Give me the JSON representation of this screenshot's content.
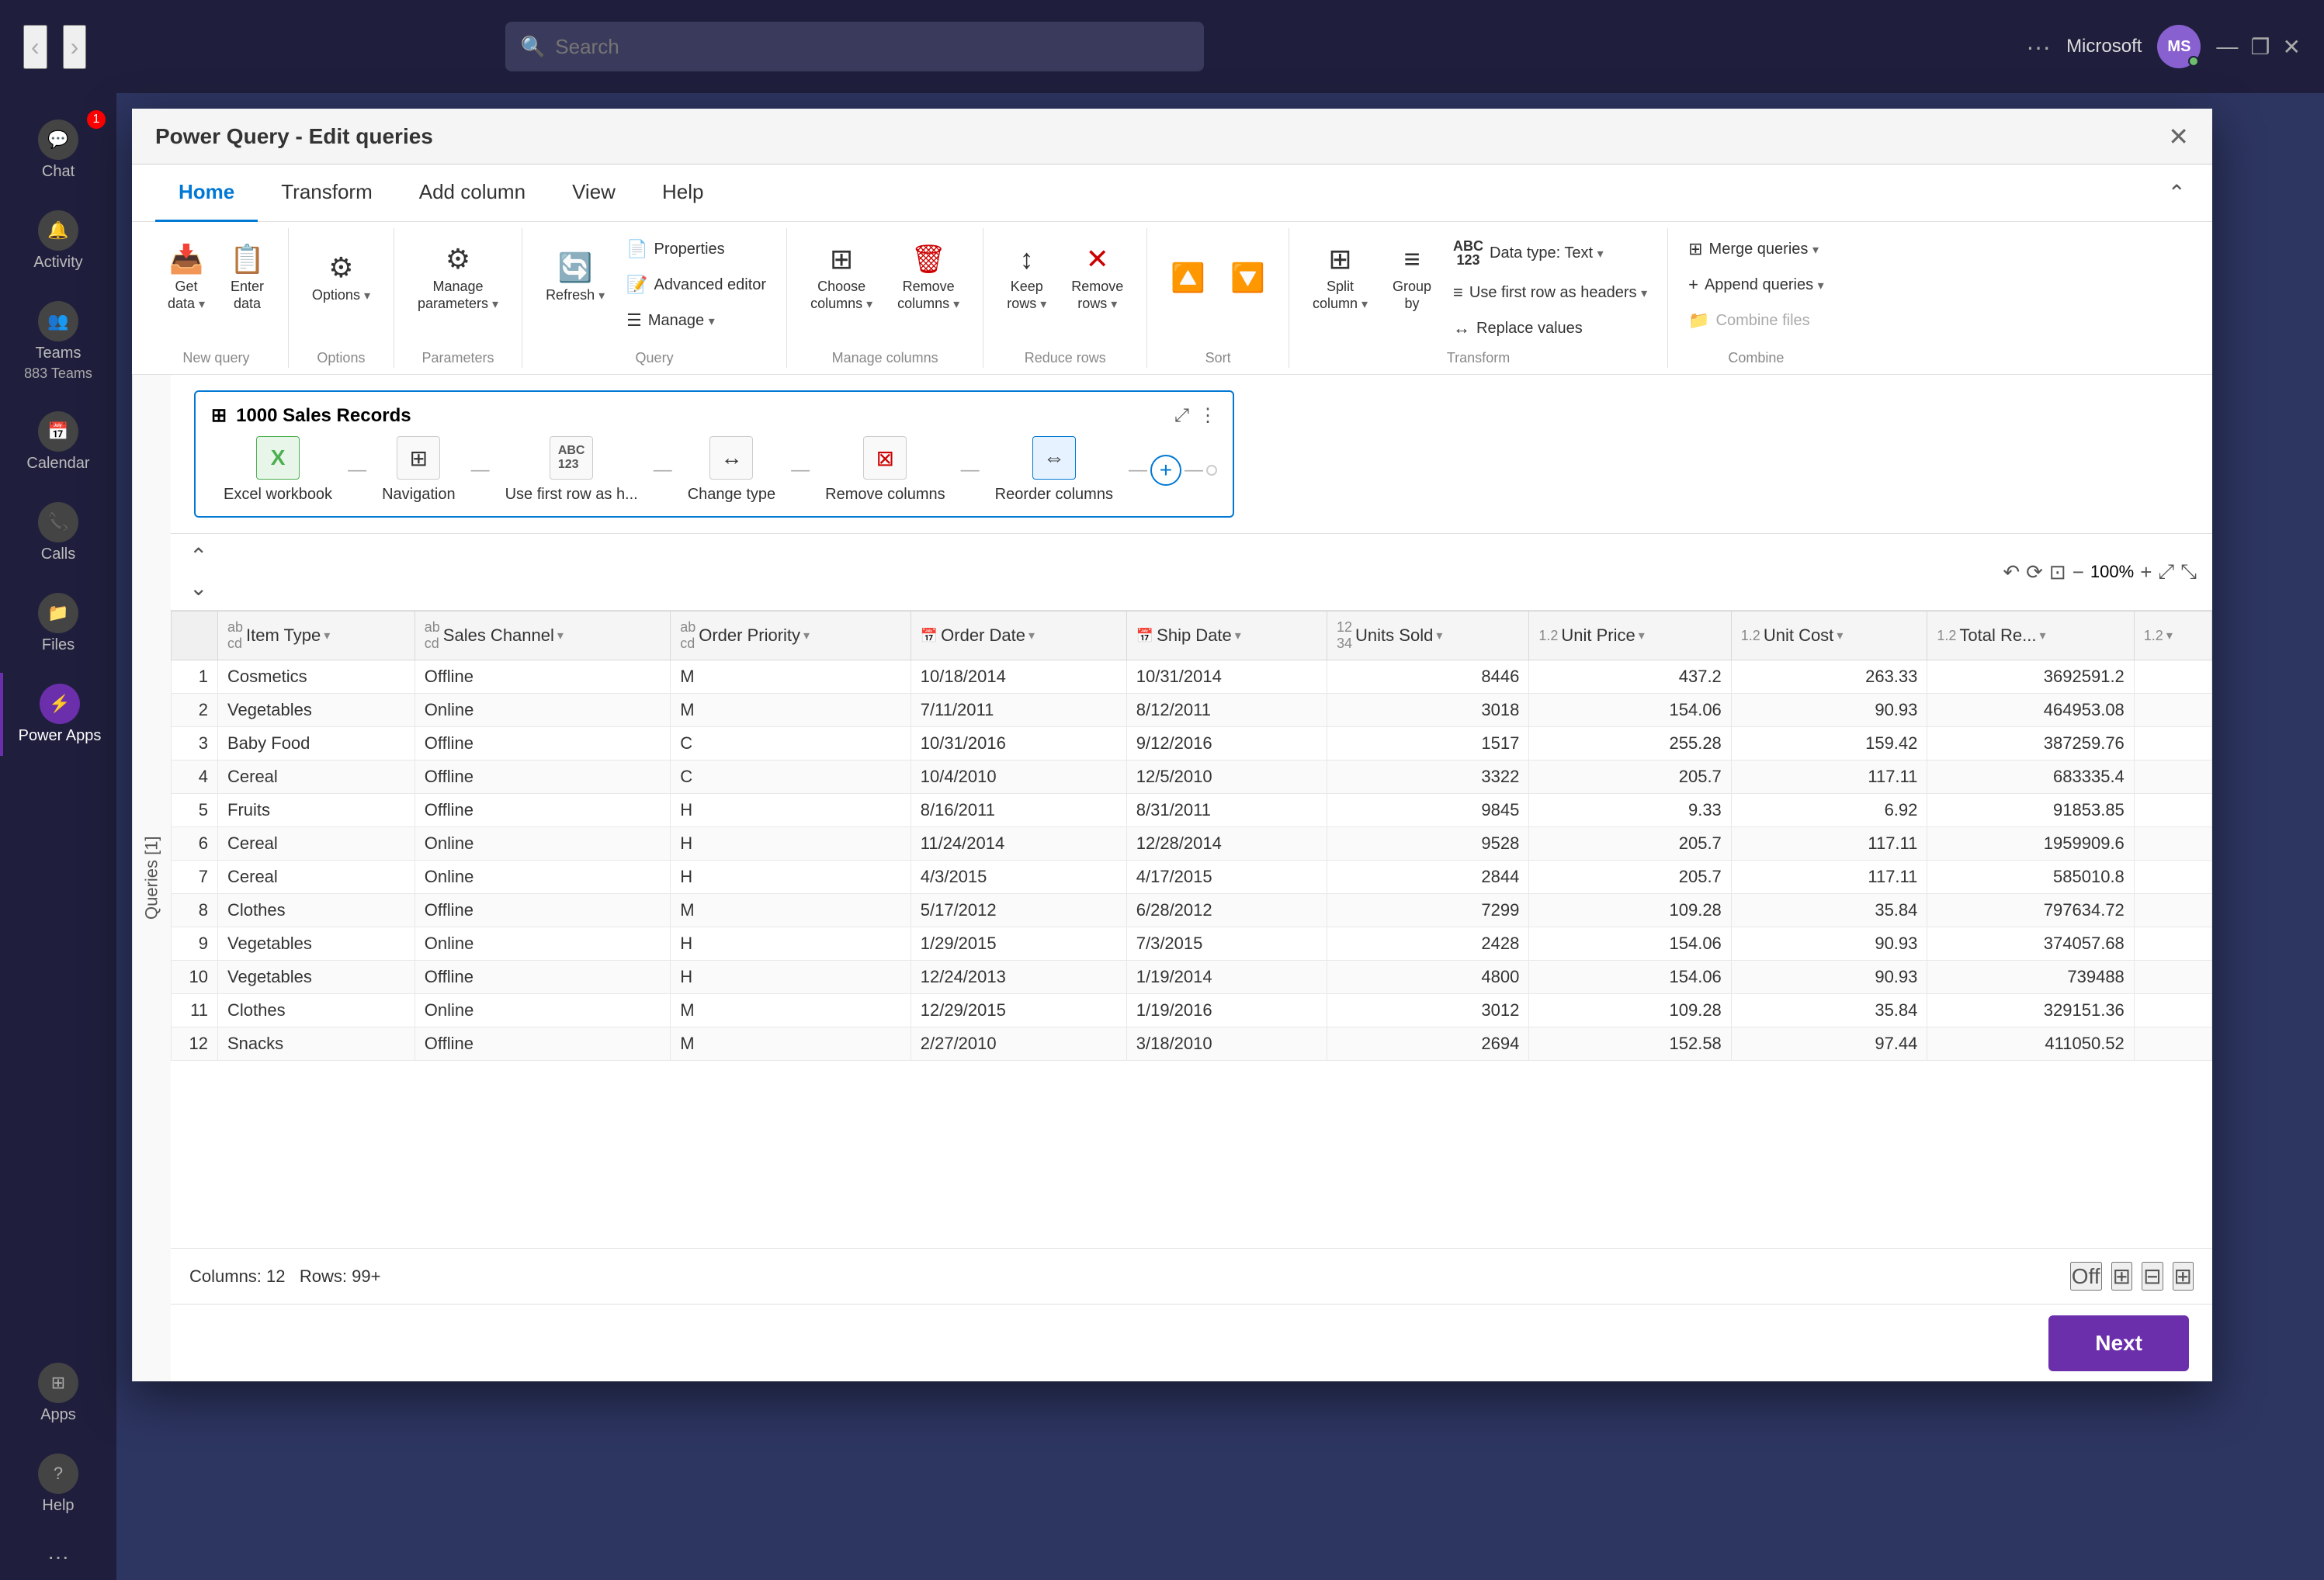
{
  "app": {
    "title": "Power Query - Edit queries",
    "search_placeholder": "Search"
  },
  "topbar": {
    "nav_back": "‹",
    "nav_forward": "›",
    "dots": "···",
    "microsoft": "Microsoft",
    "user_initials": "MS",
    "minimize": "—",
    "maximize": "❐",
    "close": "✕"
  },
  "sidebar": {
    "items": [
      {
        "id": "chat",
        "label": "Chat",
        "icon": "💬",
        "badge": "1"
      },
      {
        "id": "activity",
        "label": "Activity",
        "icon": "🔔"
      },
      {
        "id": "teams",
        "label": "Teams",
        "icon": "👥"
      },
      {
        "id": "calendar",
        "label": "Calendar",
        "icon": "📅"
      },
      {
        "id": "calls",
        "label": "Calls",
        "icon": "📞"
      },
      {
        "id": "files",
        "label": "Files",
        "icon": "📁"
      },
      {
        "id": "powerapps",
        "label": "Power Apps",
        "icon": "⚡",
        "active": true
      },
      {
        "id": "apps",
        "label": "Apps",
        "icon": "⊞"
      },
      {
        "id": "help",
        "label": "Help",
        "icon": "?"
      }
    ]
  },
  "ribbon": {
    "tabs": [
      "Home",
      "Transform",
      "Add column",
      "View",
      "Help"
    ],
    "active_tab": "Home",
    "groups": [
      {
        "name": "New query",
        "buttons": [
          {
            "id": "get-data",
            "label": "Get\ndata",
            "icon": "📥",
            "has_dropdown": true
          },
          {
            "id": "enter-data",
            "label": "Enter\ndata",
            "icon": "📋"
          }
        ]
      },
      {
        "name": "Options",
        "buttons": [
          {
            "id": "options",
            "label": "Options",
            "icon": "⚙",
            "has_dropdown": true
          }
        ]
      },
      {
        "name": "Parameters",
        "buttons": [
          {
            "id": "manage-parameters",
            "label": "Manage\nparameters",
            "icon": "⚙",
            "has_dropdown": true
          }
        ]
      },
      {
        "name": "Query",
        "buttons": [
          {
            "id": "refresh",
            "label": "Refresh",
            "icon": "🔄",
            "has_dropdown": true
          },
          {
            "id": "properties",
            "label": "Properties",
            "icon": "📄"
          },
          {
            "id": "advanced-editor",
            "label": "Advanced editor",
            "icon": "📝"
          },
          {
            "id": "manage",
            "label": "Manage",
            "icon": "☰",
            "has_dropdown": true
          }
        ]
      },
      {
        "name": "Manage columns",
        "buttons": [
          {
            "id": "choose-columns",
            "label": "Choose\ncolumns",
            "icon": "⊞",
            "has_dropdown": true
          },
          {
            "id": "remove-columns",
            "label": "Remove\ncolumns",
            "icon": "🗑",
            "has_dropdown": true
          }
        ]
      },
      {
        "name": "Reduce rows",
        "buttons": [
          {
            "id": "keep-rows",
            "label": "Keep\nrows",
            "icon": "↕",
            "has_dropdown": true
          },
          {
            "id": "remove-rows",
            "label": "Remove\nrows",
            "icon": "✕",
            "has_dropdown": true
          }
        ]
      },
      {
        "name": "Sort",
        "buttons": [
          {
            "id": "sort",
            "label": "Sort",
            "icon": "↕"
          }
        ]
      },
      {
        "name": "Transform",
        "small_buttons": [
          {
            "id": "data-type",
            "label": "Data type: Text",
            "icon": "ABC\n123"
          },
          {
            "id": "first-row-headers",
            "label": "Use first row as headers",
            "icon": "≡"
          },
          {
            "id": "replace-values",
            "label": "Replace values",
            "icon": "↔"
          }
        ],
        "buttons": [
          {
            "id": "split-column",
            "label": "Split\ncolumn",
            "icon": "⊞",
            "has_dropdown": true
          },
          {
            "id": "group-by",
            "label": "Group\nby",
            "icon": "≡"
          }
        ]
      },
      {
        "name": "Combine",
        "small_buttons": [
          {
            "id": "merge-queries",
            "label": "Merge queries",
            "icon": "⊞"
          },
          {
            "id": "append-queries",
            "label": "Append queries",
            "icon": "+"
          },
          {
            "id": "combine-files",
            "label": "Combine files",
            "icon": "📁"
          }
        ]
      }
    ]
  },
  "pipeline": {
    "title": "1000 Sales Records",
    "steps": [
      {
        "id": "excel-workbook",
        "label": "Excel workbook",
        "icon": "X",
        "type": "excel"
      },
      {
        "id": "navigation",
        "label": "Navigation",
        "icon": "⊞",
        "type": "table"
      },
      {
        "id": "use-first-row",
        "label": "Use first row as h...",
        "icon": "ABC\n123",
        "type": "abc"
      },
      {
        "id": "change-type",
        "label": "Change type",
        "icon": "↔",
        "type": "change"
      },
      {
        "id": "remove-columns",
        "label": "Remove columns",
        "icon": "⊠",
        "type": "remove"
      },
      {
        "id": "reorder-columns",
        "label": "Reorder columns",
        "icon": "⇔",
        "type": "reorder",
        "active": true
      }
    ]
  },
  "table": {
    "columns": [
      {
        "id": "item-type",
        "label": "Item Type",
        "type": "ab",
        "type2": "cd"
      },
      {
        "id": "sales-channel",
        "label": "Sales Channel",
        "type": "ab",
        "type2": "cd"
      },
      {
        "id": "order-priority",
        "label": "Order Priority",
        "type": "ab",
        "type2": "cd"
      },
      {
        "id": "order-date",
        "label": "Order Date",
        "type": "cal"
      },
      {
        "id": "ship-date",
        "label": "Ship Date",
        "type": "cal"
      },
      {
        "id": "units-sold",
        "label": "Units Sold",
        "type": "12",
        "type2": "34"
      },
      {
        "id": "unit-price",
        "label": "Unit Price",
        "type": "1.2"
      },
      {
        "id": "unit-cost",
        "label": "Unit Cost",
        "type": "1.2"
      },
      {
        "id": "total-revenue",
        "label": "Total Re...",
        "type": "1.2"
      },
      {
        "id": "col10",
        "label": "1.2",
        "type": "1.2"
      }
    ],
    "rows": [
      {
        "num": 1,
        "item_type": "Cosmetics",
        "sales_channel": "Offline",
        "order_priority": "M",
        "order_date": "10/18/2014",
        "ship_date": "10/31/2014",
        "units_sold": "8446",
        "unit_price": "437.2",
        "unit_cost": "263.33",
        "total_revenue": "3692591.2",
        "col10": ""
      },
      {
        "num": 2,
        "item_type": "Vegetables",
        "sales_channel": "Online",
        "order_priority": "M",
        "order_date": "7/11/2011",
        "ship_date": "8/12/2011",
        "units_sold": "3018",
        "unit_price": "154.06",
        "unit_cost": "90.93",
        "total_revenue": "464953.08",
        "col10": ""
      },
      {
        "num": 3,
        "item_type": "Baby Food",
        "sales_channel": "Offline",
        "order_priority": "C",
        "order_date": "10/31/2016",
        "ship_date": "9/12/2016",
        "units_sold": "1517",
        "unit_price": "255.28",
        "unit_cost": "159.42",
        "total_revenue": "387259.76",
        "col10": ""
      },
      {
        "num": 4,
        "item_type": "Cereal",
        "sales_channel": "Offline",
        "order_priority": "C",
        "order_date": "10/4/2010",
        "ship_date": "12/5/2010",
        "units_sold": "3322",
        "unit_price": "205.7",
        "unit_cost": "117.11",
        "total_revenue": "683335.4",
        "col10": ""
      },
      {
        "num": 5,
        "item_type": "Fruits",
        "sales_channel": "Offline",
        "order_priority": "H",
        "order_date": "8/16/2011",
        "ship_date": "8/31/2011",
        "units_sold": "9845",
        "unit_price": "9.33",
        "unit_cost": "6.92",
        "total_revenue": "91853.85",
        "col10": ""
      },
      {
        "num": 6,
        "item_type": "Cereal",
        "sales_channel": "Online",
        "order_priority": "H",
        "order_date": "11/24/2014",
        "ship_date": "12/28/2014",
        "units_sold": "9528",
        "unit_price": "205.7",
        "unit_cost": "117.11",
        "total_revenue": "1959909.6",
        "col10": ""
      },
      {
        "num": 7,
        "item_type": "Cereal",
        "sales_channel": "Online",
        "order_priority": "H",
        "order_date": "4/3/2015",
        "ship_date": "4/17/2015",
        "units_sold": "2844",
        "unit_price": "205.7",
        "unit_cost": "117.11",
        "total_revenue": "585010.8",
        "col10": ""
      },
      {
        "num": 8,
        "item_type": "Clothes",
        "sales_channel": "Offline",
        "order_priority": "M",
        "order_date": "5/17/2012",
        "ship_date": "6/28/2012",
        "units_sold": "7299",
        "unit_price": "109.28",
        "unit_cost": "35.84",
        "total_revenue": "797634.72",
        "col10": ""
      },
      {
        "num": 9,
        "item_type": "Vegetables",
        "sales_channel": "Online",
        "order_priority": "H",
        "order_date": "1/29/2015",
        "ship_date": "7/3/2015",
        "units_sold": "2428",
        "unit_price": "154.06",
        "unit_cost": "90.93",
        "total_revenue": "374057.68",
        "col10": ""
      },
      {
        "num": 10,
        "item_type": "Vegetables",
        "sales_channel": "Offline",
        "order_priority": "H",
        "order_date": "12/24/2013",
        "ship_date": "1/19/2014",
        "units_sold": "4800",
        "unit_price": "154.06",
        "unit_cost": "90.93",
        "total_revenue": "739488",
        "col10": ""
      },
      {
        "num": 11,
        "item_type": "Clothes",
        "sales_channel": "Online",
        "order_priority": "M",
        "order_date": "12/29/2015",
        "ship_date": "1/19/2016",
        "units_sold": "3012",
        "unit_price": "109.28",
        "unit_cost": "35.84",
        "total_revenue": "329151.36",
        "col10": ""
      },
      {
        "num": 12,
        "item_type": "Snacks",
        "sales_channel": "Offline",
        "order_priority": "M",
        "order_date": "2/27/2010",
        "ship_date": "3/18/2010",
        "units_sold": "2694",
        "unit_price": "152.58",
        "unit_cost": "97.44",
        "total_revenue": "411050.52",
        "col10": ""
      }
    ]
  },
  "status": {
    "columns_label": "Columns:",
    "columns_value": "12",
    "rows_label": "Rows:",
    "rows_value": "99+",
    "off_label": "Off"
  },
  "bottom": {
    "next_label": "Next"
  },
  "queries_panel_label": "Queries [1]"
}
